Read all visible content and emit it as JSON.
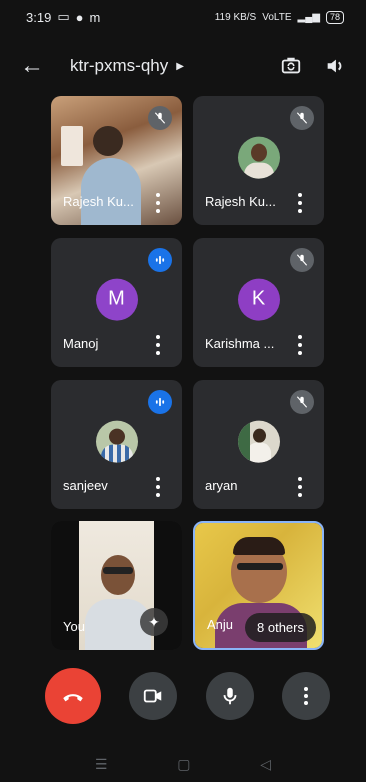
{
  "status_bar": {
    "time": "3:19",
    "left_icons_text": "m",
    "network_text_1": "119 KB/S",
    "network_text_2": "VoLTE",
    "battery": "78"
  },
  "header": {
    "meeting_code": "ktr-pxms-qhy"
  },
  "participants": [
    {
      "name": "Rajesh Ku...",
      "kind": "video",
      "muted": true
    },
    {
      "name": "Rajesh Ku...",
      "kind": "photo",
      "muted": true
    },
    {
      "name": "Manoj",
      "kind": "letter",
      "letter": "M",
      "color": "#8e44c9",
      "speaking": true
    },
    {
      "name": "Karishma ...",
      "kind": "letter",
      "letter": "K",
      "color": "#8e3ec4",
      "muted": true
    },
    {
      "name": "sanjeev",
      "kind": "photo",
      "speaking": true
    },
    {
      "name": "aryan",
      "kind": "photo",
      "muted": true
    },
    {
      "name": "You",
      "kind": "video"
    },
    {
      "name": "Anju",
      "kind": "video"
    }
  ],
  "others_chip": "8 others",
  "colors": {
    "end_call": "#ea4335",
    "active_border": "#8ab4f8",
    "speaking_badge": "#1a73e8"
  }
}
